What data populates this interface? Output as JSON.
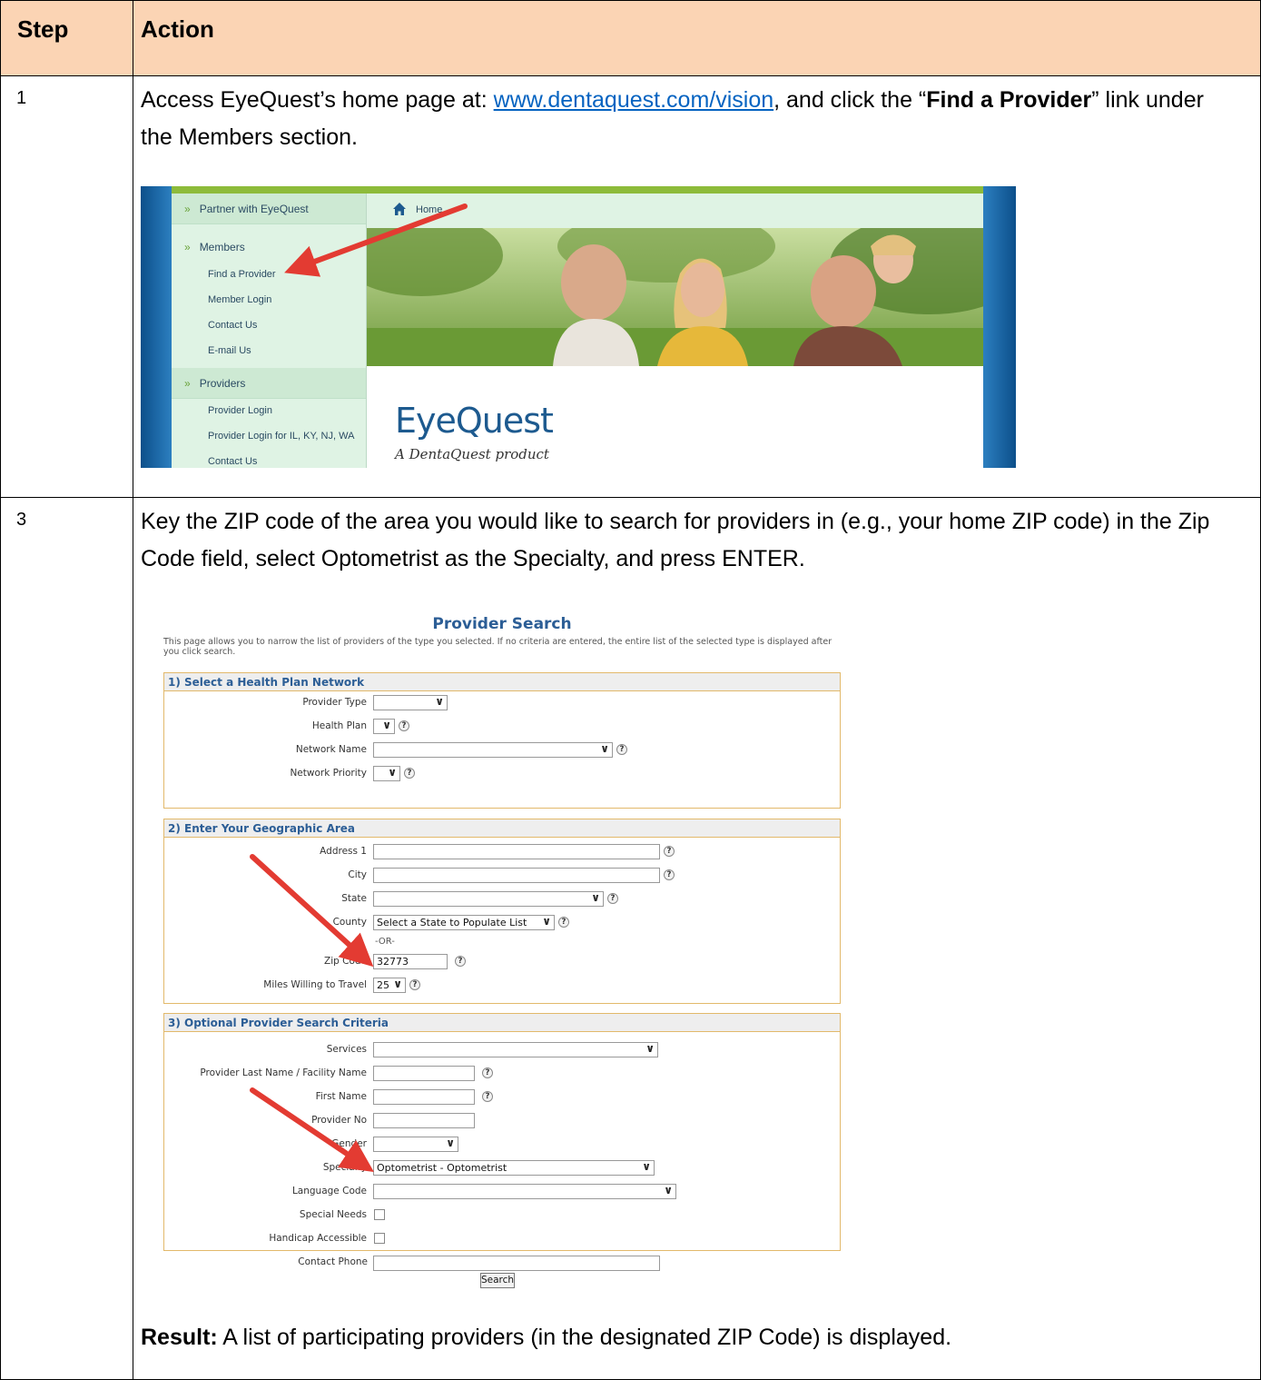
{
  "table": {
    "headers": [
      "Step",
      "Action"
    ],
    "rows": [
      {
        "step": "1",
        "text_1": "Access EyeQuest’s home page at: ",
        "link": "www.dentaquest.com/vision",
        "text_2": ", and click the “",
        "bold": "Find a Provider",
        "text_3": "” link under the Members section."
      },
      {
        "step": "3",
        "text": "Key the ZIP code of the area you would like to search for providers in (e.g., your home ZIP code) in the Zip Code field, select Optometrist as the Specialty, and press ENTER.",
        "result_label": "Result:",
        "result_text": " A list of participating providers (in the designated ZIP Code) is displayed."
      }
    ]
  },
  "eyequest": {
    "nav": {
      "partner": "Partner with EyeQuest",
      "members": "Members",
      "member_items": [
        "Find a Provider",
        "Member Login",
        "Contact Us",
        "E-mail Us"
      ],
      "providers": "Providers",
      "provider_items": [
        "Provider Login",
        "Provider Login for IL, KY, NJ, WA",
        "Contact Us"
      ]
    },
    "home": "Home",
    "logo": "EyeQuest",
    "tagline": "A DentaQuest product"
  },
  "provider_search": {
    "title": "Provider Search",
    "description": "This page allows you to narrow the list of providers of the type you selected. If no criteria are entered, the entire list of the selected type is displayed after you click search.",
    "section1": {
      "title": "1) Select a Health Plan Network",
      "fields": [
        {
          "label": "Provider Type",
          "value": ""
        },
        {
          "label": "Health Plan",
          "value": ""
        },
        {
          "label": "Network Name",
          "value": ""
        },
        {
          "label": "Network Priority",
          "value": ""
        }
      ]
    },
    "section2": {
      "title": "2) Enter Your Geographic Area",
      "address1": "Address 1",
      "city": "City",
      "state": "State",
      "county": "County",
      "county_value": "Select a State to Populate List",
      "or": "-OR-",
      "zip": "Zip Code",
      "zip_value": "32773",
      "miles": "Miles Willing to Travel",
      "miles_value": "25"
    },
    "section3": {
      "title": "3) Optional Provider Search Criteria",
      "services": "Services",
      "last_name": "Provider Last Name / Facility Name",
      "first_name": "First Name",
      "provider_no": "Provider No",
      "gender": "Gender",
      "specialty": "Specialty",
      "specialty_value": "Optometrist - Optometrist",
      "language": "Language Code",
      "special_needs": "Special Needs",
      "handicap": "Handicap Accessible",
      "phone": "Contact Phone"
    },
    "search_button": "Search"
  },
  "colors": {
    "header_fill": "#fbd4b4",
    "link": "#0563c1",
    "arrow": "#e33b32",
    "section_border": "#e2b96b",
    "section_title": "#2c5e96"
  }
}
